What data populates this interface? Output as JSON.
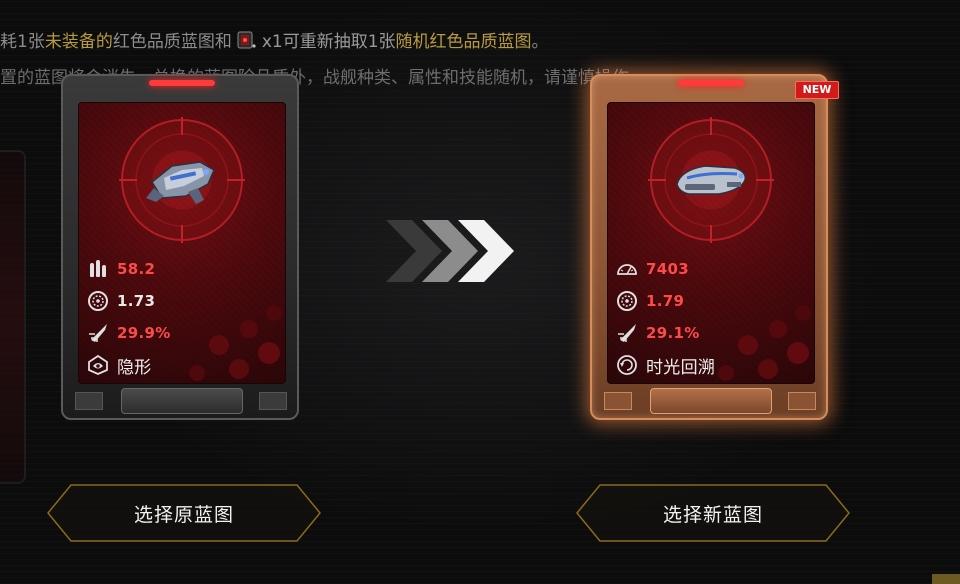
{
  "notice": {
    "line1": {
      "prefix": "耗1张",
      "hl1": "未装备的",
      "mid": "红色品质蓝图和",
      "chip_icon": "reroll-chip-icon",
      "count": "x1可重新抽取1张",
      "hl2": "随机红色品质蓝图",
      "end": "。"
    },
    "line2": "置的蓝图将会消失，兑换的蓝图除品质外，战舰种类、属性和技能随机，请谨慎操作"
  },
  "cards": {
    "original": {
      "stat1_icon": "bullets-icon",
      "stat1_value": "58.2",
      "stat2_icon": "cooldown-gauge-icon",
      "stat2_value": "1.73",
      "stat3_icon": "thruster-icon",
      "stat3_value": "29.9%",
      "skill_icon": "stealth-icon",
      "skill_name": "隐形"
    },
    "new": {
      "badge": "NEW",
      "stat1_icon": "durability-gauge-icon",
      "stat1_value": "7403",
      "stat2_icon": "cooldown-gauge-icon",
      "stat2_value": "1.79",
      "stat3_icon": "thruster-icon",
      "stat3_value": "29.1%",
      "skill_icon": "time-rewind-icon",
      "skill_name": "时光回溯"
    }
  },
  "buttons": {
    "keep_original": "选择原蓝图",
    "take_new": "选择新蓝图"
  },
  "colors": {
    "highlight": "#b89b3e",
    "stat_red": "#ff4a4a",
    "card_glow": "#ff8c46",
    "button_border": "#8a6a1e"
  }
}
